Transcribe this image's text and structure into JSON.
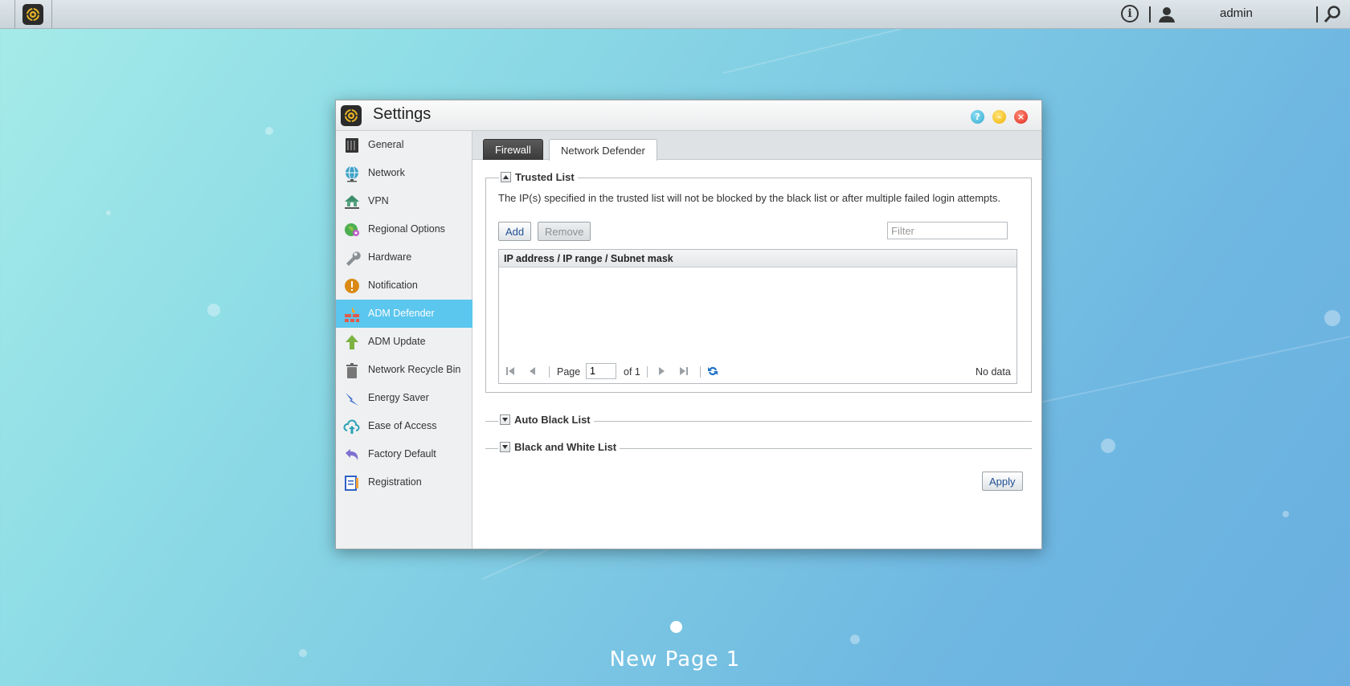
{
  "taskbar": {
    "user_name": "admin",
    "info_glyph": "i",
    "icons": [
      "app-icon",
      "info-icon",
      "user-icon",
      "search-icon"
    ]
  },
  "window": {
    "title": "Settings",
    "controls": [
      "help-icon",
      "minimize-icon",
      "close-icon"
    ]
  },
  "sidebar": {
    "items": [
      {
        "label": "General",
        "icon": "nas-icon"
      },
      {
        "label": "Network",
        "icon": "globe-network-icon"
      },
      {
        "label": "VPN",
        "icon": "vpn-house-icon"
      },
      {
        "label": "Regional Options",
        "icon": "globe-pin-icon"
      },
      {
        "label": "Hardware",
        "icon": "wrench-icon"
      },
      {
        "label": "Notification",
        "icon": "alert-icon"
      },
      {
        "label": "ADM Defender",
        "icon": "firewall-icon"
      },
      {
        "label": "ADM Update",
        "icon": "update-arrow-icon"
      },
      {
        "label": "Network Recycle Bin",
        "icon": "trash-icon"
      },
      {
        "label": "Energy Saver",
        "icon": "energy-icon"
      },
      {
        "label": "Ease of Access",
        "icon": "cloud-upload-icon"
      },
      {
        "label": "Factory Default",
        "icon": "undo-icon"
      },
      {
        "label": "Registration",
        "icon": "registration-icon"
      }
    ],
    "active_index": 6
  },
  "tabs": {
    "firewall": "Firewall",
    "network_defender": "Network Defender",
    "active": "Network Defender"
  },
  "trusted_list": {
    "title": "Trusted List",
    "description": "The IP(s) specified in the trusted list will not be blocked by the black list or after multiple failed login attempts.",
    "add_label": "Add",
    "remove_label": "Remove",
    "filter_placeholder": "Filter",
    "column_header": "IP address / IP range / Subnet mask",
    "pager": {
      "page_label": "Page",
      "page_value": "1",
      "of_label": "of 1",
      "status": "No data"
    }
  },
  "sections": {
    "auto_black_list": "Auto Black List",
    "black_white_list": "Black and White List"
  },
  "apply_label": "Apply",
  "desktop": {
    "page_title": "New Page 1"
  },
  "colors": {
    "active_item": "#5bc6ee",
    "link_text": "#1f4f93"
  }
}
